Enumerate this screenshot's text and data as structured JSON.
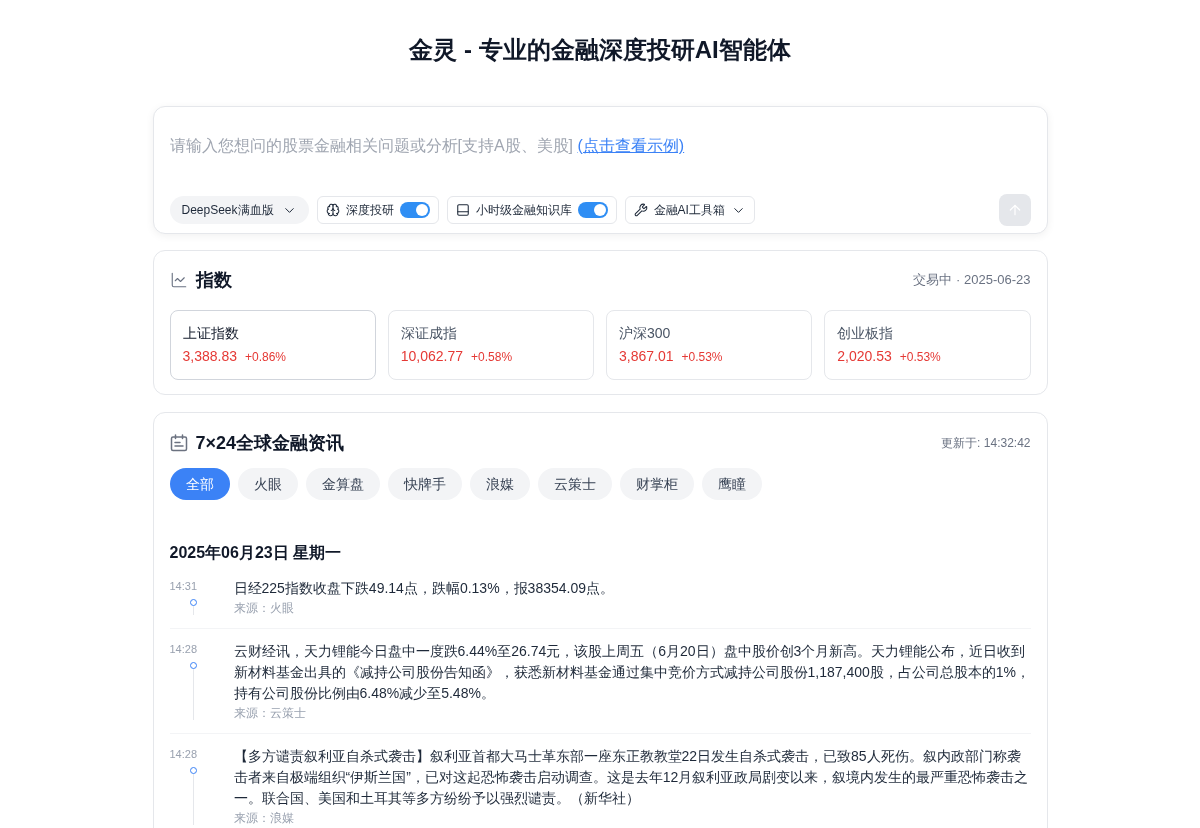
{
  "title": "金灵 - 专业的金融深度投研AI智能体",
  "query": {
    "placeholder": "请输入您想问的股票金融相关问题或分析[支持A股、美股]",
    "example_link": "(点击查看示例)",
    "toolbar": [
      {
        "kind": "select",
        "label": "DeepSeek满血版"
      },
      {
        "kind": "toggle",
        "label": "深度投研",
        "on": true
      },
      {
        "kind": "toggle",
        "label": "小时级金融知识库",
        "on": true
      },
      {
        "kind": "menu",
        "label": "金融AI工具箱"
      }
    ],
    "send": {
      "disabled": true
    }
  },
  "indices": {
    "title": "指数",
    "status": "交易中 · 2025-06-23",
    "items": [
      {
        "name": "上证指数",
        "value": "3,388.83",
        "change": "+0.86%",
        "selected": true
      },
      {
        "name": "深证成指",
        "value": "10,062.77",
        "change": "+0.58%",
        "selected": false
      },
      {
        "name": "沪深300",
        "value": "3,867.01",
        "change": "+0.53%",
        "selected": false
      },
      {
        "name": "创业板指",
        "value": "2,020.53",
        "change": "+0.53%",
        "selected": false
      }
    ]
  },
  "news": {
    "title": "7×24全球金融资讯",
    "updated": "更新于: 14:32:42",
    "tabs": [
      {
        "label": "全部",
        "selected": true
      },
      {
        "label": "火眼",
        "selected": false
      },
      {
        "label": "金算盘",
        "selected": false
      },
      {
        "label": "快牌手",
        "selected": false
      },
      {
        "label": "浪媒",
        "selected": false
      },
      {
        "label": "云策士",
        "selected": false
      },
      {
        "label": "财掌柜",
        "selected": false
      },
      {
        "label": "鹰瞳",
        "selected": false
      }
    ],
    "date": "2025年06月23日 星期一",
    "items": [
      {
        "time": "14:31",
        "text": "日经225指数收盘下跌49.14点，跌幅0.13%，报38354.09点。",
        "source": "来源：火眼"
      },
      {
        "time": "14:28",
        "text": "云财经讯，天力锂能今日盘中一度跌6.44%至26.74元，该股上周五（6月20日）盘中股价创3个月新高。天力锂能公布，近日收到新材料基金出具的《减持公司股份告知函》，获悉新材料基金通过集中竞价方式减持公司股份1,187,400股，占公司总股本的1%，持有公司股份比例由6.48%减少至5.48%。",
        "source": "来源：云策士"
      },
      {
        "time": "14:28",
        "text": "【多方谴责叙利亚自杀式袭击】叙利亚首都大马士革东部一座东正教教堂22日发生自杀式袭击，已致85人死伤。叙内政部门称袭击者来自极端组织“伊斯兰国”，已对这起恐怖袭击启动调查。这是去年12月叙利亚政局剧变以来，叙境内发生的最严重恐怖袭击之一。联合国、美国和土耳其等多方纷纷予以强烈谴责。（新华社）",
        "source": "来源：浪媒"
      }
    ]
  }
}
